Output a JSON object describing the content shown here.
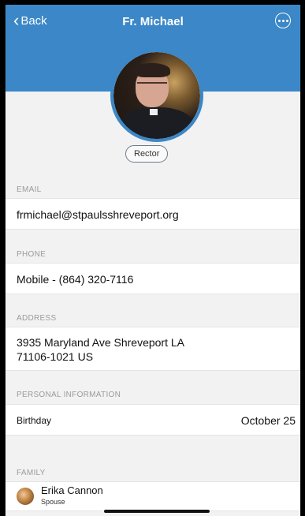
{
  "nav": {
    "back_label": "Back",
    "title": "Fr. Michael"
  },
  "profile": {
    "role_badge": "Rector"
  },
  "email": {
    "label": "EMAIL",
    "value": "frmichael@stpaulsshreveport.org"
  },
  "phone": {
    "label": "PHONE",
    "value": "Mobile - (864) 320-7116"
  },
  "address": {
    "label": "ADDRESS",
    "line1": "3935 Maryland Ave Shreveport LA",
    "line2": "71106-1021 US"
  },
  "personal": {
    "label": "PERSONAL INFORMATION",
    "birthday_label": "Birthday",
    "birthday_value": "October 25"
  },
  "family": {
    "label": "FAMILY",
    "members": [
      {
        "name": "Erika Cannon",
        "relation": "Spouse"
      }
    ]
  },
  "colors": {
    "header": "#3b87c7",
    "background": "#f2f2f2"
  }
}
